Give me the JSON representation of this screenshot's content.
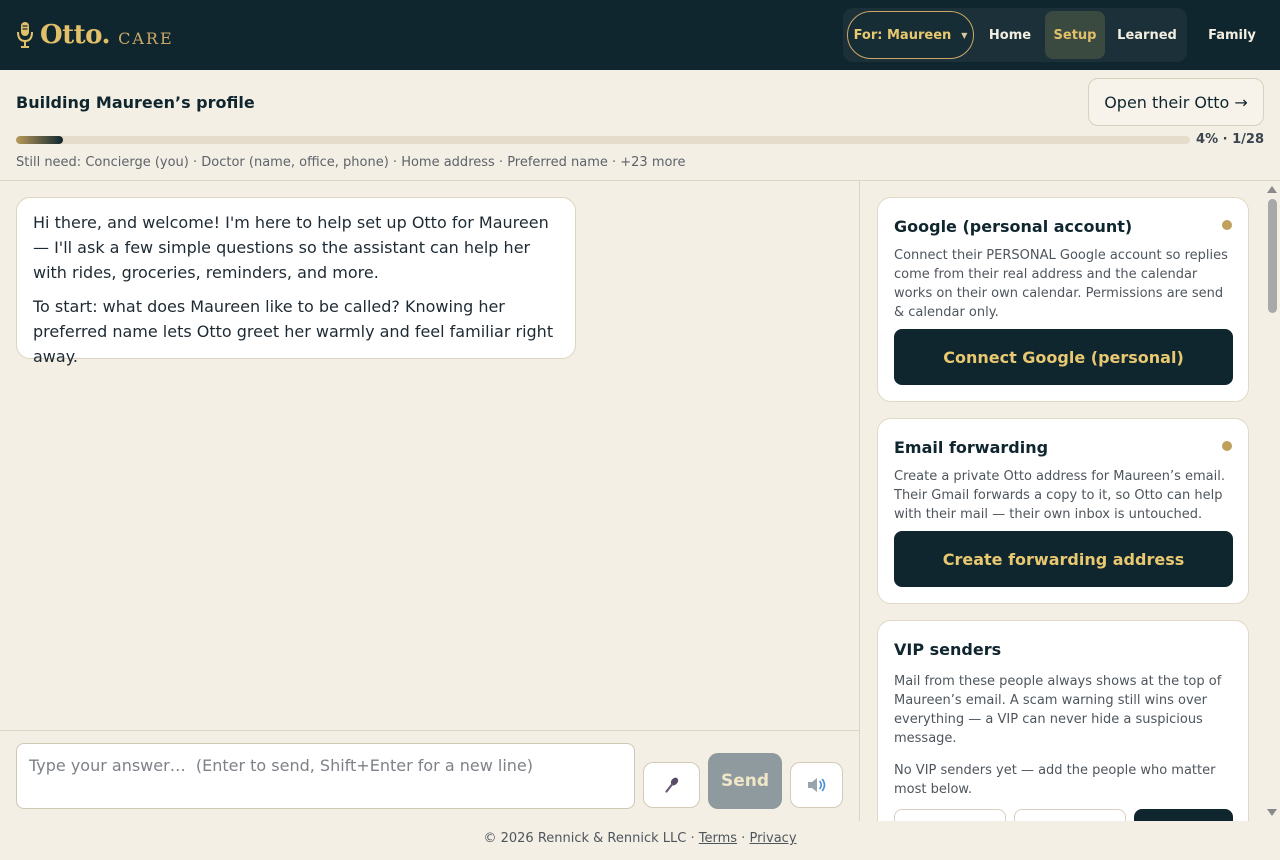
{
  "header": {
    "brand": "Otto.",
    "brand_sub": "CARE",
    "for_selector": "For: Maureen",
    "nav": {
      "home": "Home",
      "setup": "Setup",
      "learned": "Learned",
      "family": "Family"
    },
    "active_nav": "setup"
  },
  "profile": {
    "title": "Building Maureen’s profile",
    "open_button": "Open their Otto →",
    "progress_fraction": 0.04,
    "progress_label": "4% · 1/28",
    "still_need": "Still need: Concierge (you) · Doctor (name, office, phone) · Home address · Preferred name · +23 more"
  },
  "chat": {
    "messages": [
      {
        "role": "assistant",
        "paragraphs": [
          "Hi there, and welcome! I'm here to help set up Otto for Maureen — I'll ask a few simple questions so the assistant can help her with rides, groceries, reminders, and more.",
          "To start: what does Maureen like to be called? Knowing her preferred name lets Otto greet her warmly and feel familiar right away."
        ]
      }
    ],
    "composer": {
      "placeholder": "Type your answer…  (Enter to send, Shift+Enter for a new line)",
      "value": "",
      "send_label": "Send"
    }
  },
  "setup_cards": [
    {
      "title": "Google (personal account)",
      "description": "Connect their PERSONAL Google account so replies come from their real address and the calendar works on their own calendar. Permissions are send & calendar only.",
      "button": "Connect Google (personal)",
      "status_color": "#bfa05c"
    },
    {
      "title": "Email forwarding",
      "description": "Create a private Otto address for Maureen’s email. Their Gmail forwards a copy to it, so Otto can help with their mail — their own inbox is untouched.",
      "button": "Create forwarding address",
      "status_color": "#bfa05c"
    },
    {
      "title": "VIP senders",
      "description": "Mail from these people always shows at the top of Maureen’s email. A scam warning still wins over everything — a VIP can never hide a suspicious message.",
      "empty_text": "No VIP senders yet — add the people who matter most below."
    }
  ],
  "footer": {
    "copyright": "© 2026 Rennick & Rennick LLC · ",
    "terms": "Terms",
    "separator": " · ",
    "privacy": "Privacy"
  },
  "colors": {
    "navy": "#10262f",
    "gold": "#e2c06a",
    "cream": "#f4efe4",
    "send_disabled": "#8e9a9e"
  },
  "icons": {
    "logo": "microphone-icon",
    "mic_button": "microphone-icon",
    "speaker_button": "speaker-icon",
    "dropdown": "caret-down-icon"
  }
}
